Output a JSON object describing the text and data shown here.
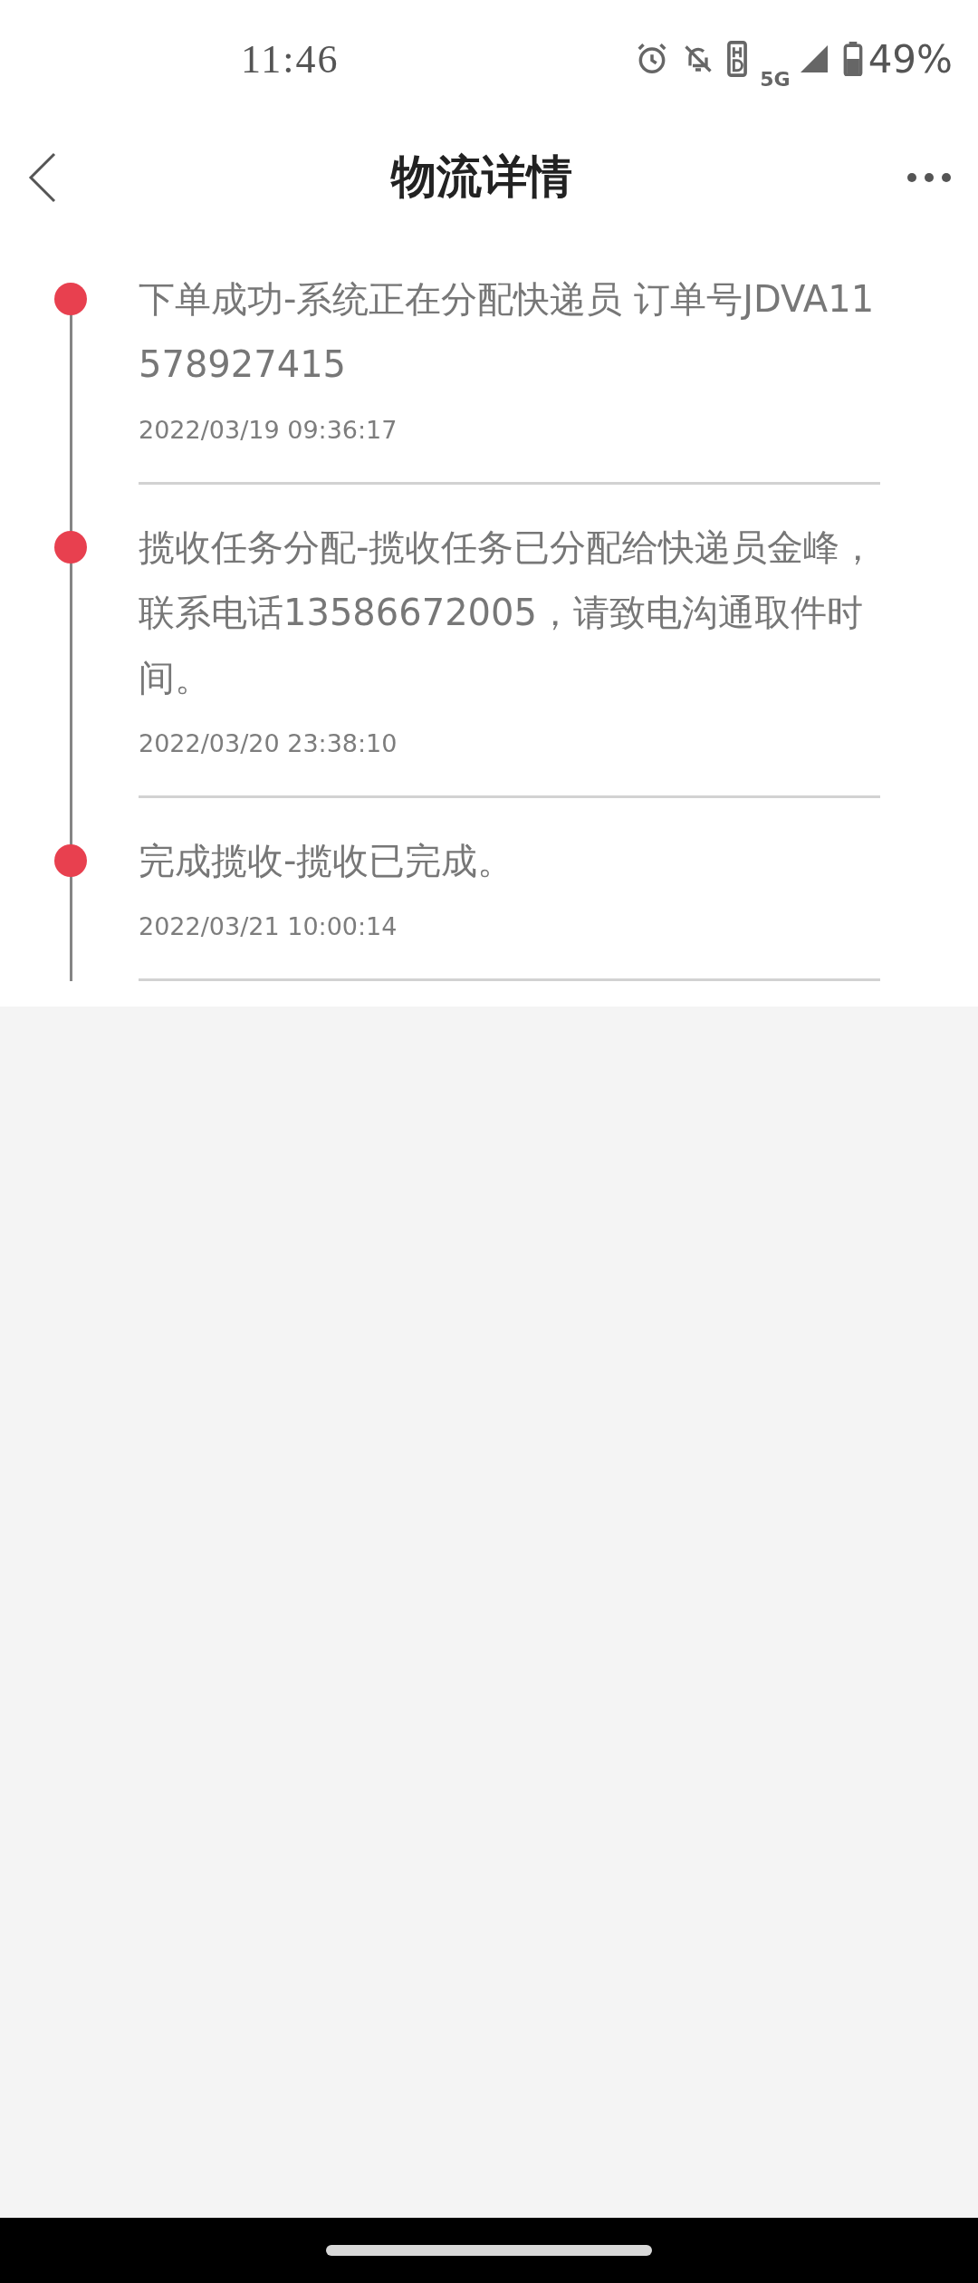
{
  "status_bar": {
    "time": "11:46",
    "network": "5G",
    "battery": "49%"
  },
  "header": {
    "title": "物流详情"
  },
  "events": [
    {
      "text": "下单成功-系统正在分配快递员 订单号JDVA11578927415",
      "time": "2022/03/19 09:36:17"
    },
    {
      "text": "揽收任务分配-揽收任务已分配给快递员金峰，联系电话13586672005，请致电沟通取件时间。",
      "time": "2022/03/20 23:38:10"
    },
    {
      "text": "完成揽收-揽收已完成。",
      "time": "2022/03/21 10:00:14"
    }
  ]
}
